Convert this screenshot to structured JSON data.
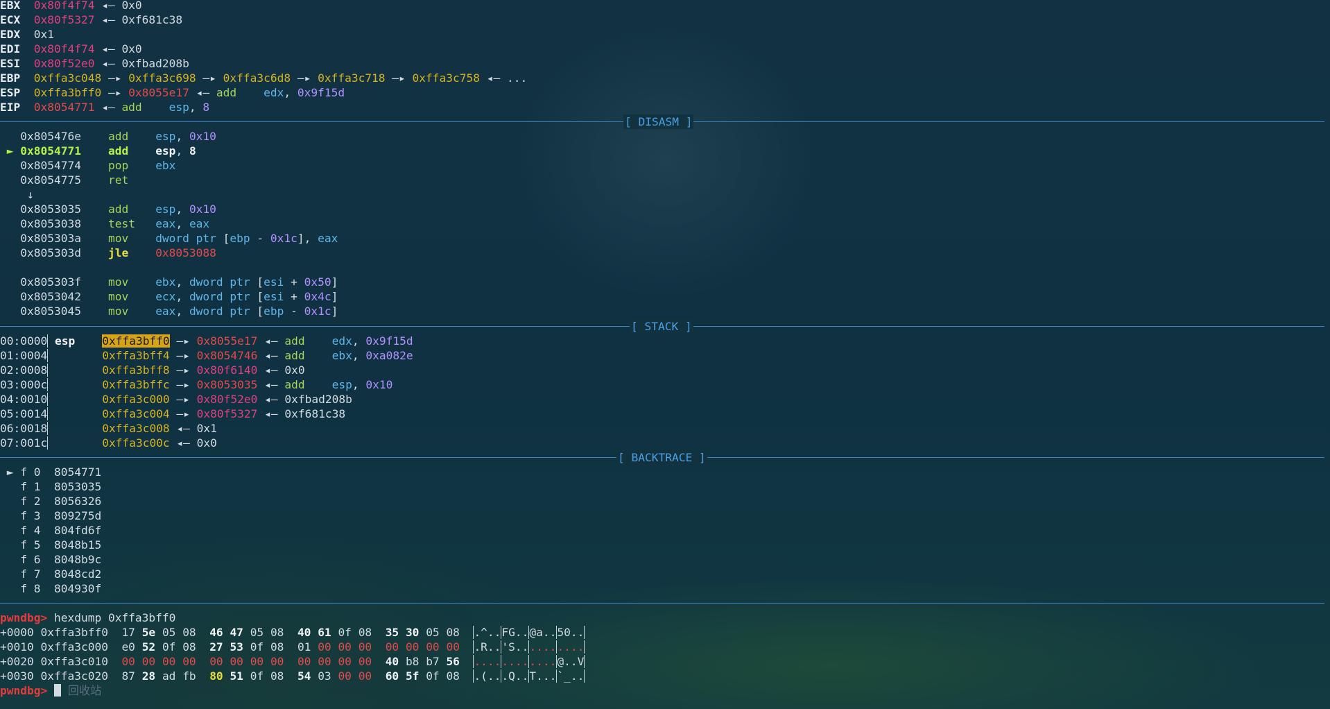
{
  "registers": [
    {
      "name": "EBX",
      "parts": [
        [
          "0x80f4f74",
          "mag"
        ],
        [
          " ◂— ",
          "gray"
        ],
        [
          "0x0",
          "gray"
        ]
      ]
    },
    {
      "name": "ECX",
      "parts": [
        [
          "0x80f5327",
          "mag"
        ],
        [
          " ◂— ",
          "gray"
        ],
        [
          "0xf681c38",
          "gray"
        ]
      ]
    },
    {
      "name": "EDX",
      "parts": [
        [
          "0x1",
          "gray"
        ]
      ]
    },
    {
      "name": "EDI",
      "parts": [
        [
          "0x80f4f74",
          "mag"
        ],
        [
          " ◂— ",
          "gray"
        ],
        [
          "0x0",
          "gray"
        ]
      ]
    },
    {
      "name": "ESI",
      "parts": [
        [
          "0x80f52e0",
          "mag"
        ],
        [
          " ◂— ",
          "gray"
        ],
        [
          "0xfbad208b",
          "gray"
        ]
      ]
    },
    {
      "name": "EBP",
      "parts": [
        [
          "0xffa3c048",
          "yel"
        ],
        [
          " —▸ ",
          "gray"
        ],
        [
          "0xffa3c698",
          "yel"
        ],
        [
          " —▸ ",
          "gray"
        ],
        [
          "0xffa3c6d8",
          "yel"
        ],
        [
          " —▸ ",
          "gray"
        ],
        [
          "0xffa3c718",
          "yel"
        ],
        [
          " —▸ ",
          "gray"
        ],
        [
          "0xffa3c758",
          "yel"
        ],
        [
          " ◂— ...",
          "gray"
        ]
      ]
    },
    {
      "name": "ESP",
      "parts": [
        [
          "0xffa3bff0",
          "yel"
        ],
        [
          " —▸ ",
          "gray"
        ],
        [
          "0x8055e17",
          "red"
        ],
        [
          " ◂— ",
          "gray"
        ],
        [
          "add",
          "grn"
        ],
        [
          "    ",
          "gray"
        ],
        [
          "edx",
          "cya"
        ],
        [
          ", ",
          "gray"
        ],
        [
          "0x9f15d",
          "pur"
        ]
      ]
    },
    {
      "name": "EIP",
      "parts": [
        [
          "0x8054771",
          "red"
        ],
        [
          " ◂— ",
          "gray"
        ],
        [
          "add",
          "grn"
        ],
        [
          "    ",
          "gray"
        ],
        [
          "esp",
          "cya"
        ],
        [
          ", ",
          "gray"
        ],
        [
          "8",
          "pur"
        ]
      ]
    }
  ],
  "sections": {
    "disasm": "[ DISASM ]",
    "stack": "[ STACK ]",
    "backtrace": "[ BACKTRACE ]"
  },
  "disasm": [
    {
      "marker": "",
      "addr": "0x805476e",
      "mn": "add",
      "ops": [
        [
          "esp",
          "cya"
        ],
        [
          ", ",
          "gray"
        ],
        [
          "0x10",
          "pur"
        ]
      ]
    },
    {
      "marker": "►",
      "addr": "0x8054771",
      "mn": "add",
      "ops": [
        [
          "esp",
          "cya"
        ],
        [
          ", ",
          "gray"
        ],
        [
          "8",
          "pur"
        ]
      ],
      "current": true
    },
    {
      "marker": "",
      "addr": "0x8054774",
      "mn": "pop",
      "ops": [
        [
          "ebx",
          "cya"
        ]
      ]
    },
    {
      "marker": "",
      "addr": "0x8054775",
      "mn": "ret",
      "ops": []
    },
    {
      "arrow": "↓"
    },
    {
      "marker": "",
      "addr": "0x8053035",
      "mn": "add",
      "ops": [
        [
          "esp",
          "cya"
        ],
        [
          ", ",
          "gray"
        ],
        [
          "0x10",
          "pur"
        ]
      ]
    },
    {
      "marker": "",
      "addr": "0x8053038",
      "mn": "test",
      "ops": [
        [
          "eax",
          "cya"
        ],
        [
          ", ",
          "gray"
        ],
        [
          "eax",
          "cya"
        ]
      ]
    },
    {
      "marker": "",
      "addr": "0x805303a",
      "mn": "mov",
      "ops": [
        [
          "dword ptr ",
          "cya"
        ],
        [
          "[",
          "gray"
        ],
        [
          "ebp",
          "cya"
        ],
        [
          " - ",
          "gray"
        ],
        [
          "0x1c",
          "pur"
        ],
        [
          "], ",
          "gray"
        ],
        [
          "eax",
          "cya"
        ]
      ]
    },
    {
      "marker": "",
      "addr": "0x805303d",
      "mn": "jle",
      "ops": [
        [
          "0x8053088",
          "red"
        ]
      ],
      "jump": true
    },
    {
      "blank": true
    },
    {
      "marker": "",
      "addr": "0x805303f",
      "mn": "mov",
      "ops": [
        [
          "ebx",
          "cya"
        ],
        [
          ", ",
          "gray"
        ],
        [
          "dword ptr ",
          "cya"
        ],
        [
          "[",
          "gray"
        ],
        [
          "esi",
          "cya"
        ],
        [
          " + ",
          "gray"
        ],
        [
          "0x50",
          "pur"
        ],
        [
          "]",
          "gray"
        ]
      ]
    },
    {
      "marker": "",
      "addr": "0x8053042",
      "mn": "mov",
      "ops": [
        [
          "ecx",
          "cya"
        ],
        [
          ", ",
          "gray"
        ],
        [
          "dword ptr ",
          "cya"
        ],
        [
          "[",
          "gray"
        ],
        [
          "esi",
          "cya"
        ],
        [
          " + ",
          "gray"
        ],
        [
          "0x4c",
          "pur"
        ],
        [
          "]",
          "gray"
        ]
      ]
    },
    {
      "marker": "",
      "addr": "0x8053045",
      "mn": "mov",
      "ops": [
        [
          "eax",
          "cya"
        ],
        [
          ", ",
          "gray"
        ],
        [
          "dword ptr ",
          "cya"
        ],
        [
          "[",
          "gray"
        ],
        [
          "ebp",
          "cya"
        ],
        [
          " - ",
          "gray"
        ],
        [
          "0x1c",
          "pur"
        ],
        [
          "]",
          "gray"
        ]
      ]
    }
  ],
  "stack": [
    {
      "off": "00:0000",
      "reg": "esp",
      "addr": "0xffa3bff0",
      "hl": true,
      "rest": [
        [
          " —▸ ",
          "gray"
        ],
        [
          "0x8055e17",
          "red"
        ],
        [
          " ◂— ",
          "gray"
        ],
        [
          "add",
          "grn"
        ],
        [
          "    ",
          "gray"
        ],
        [
          "edx",
          "cya"
        ],
        [
          ", ",
          "gray"
        ],
        [
          "0x9f15d",
          "pur"
        ]
      ]
    },
    {
      "off": "01:0004",
      "reg": "",
      "addr": "0xffa3bff4",
      "rest": [
        [
          " —▸ ",
          "gray"
        ],
        [
          "0x8054746",
          "red"
        ],
        [
          " ◂— ",
          "gray"
        ],
        [
          "add",
          "grn"
        ],
        [
          "    ",
          "gray"
        ],
        [
          "ebx",
          "cya"
        ],
        [
          ", ",
          "gray"
        ],
        [
          "0xa082e",
          "pur"
        ]
      ]
    },
    {
      "off": "02:0008",
      "reg": "",
      "addr": "0xffa3bff8",
      "rest": [
        [
          " —▸ ",
          "gray"
        ],
        [
          "0x80f6140",
          "mag"
        ],
        [
          " ◂— ",
          "gray"
        ],
        [
          "0x0",
          "gray"
        ]
      ]
    },
    {
      "off": "03:000c",
      "reg": "",
      "addr": "0xffa3bffc",
      "rest": [
        [
          " —▸ ",
          "gray"
        ],
        [
          "0x8053035",
          "red"
        ],
        [
          " ◂— ",
          "gray"
        ],
        [
          "add",
          "grn"
        ],
        [
          "    ",
          "gray"
        ],
        [
          "esp",
          "cya"
        ],
        [
          ", ",
          "gray"
        ],
        [
          "0x10",
          "pur"
        ]
      ]
    },
    {
      "off": "04:0010",
      "reg": "",
      "addr": "0xffa3c000",
      "rest": [
        [
          " —▸ ",
          "gray"
        ],
        [
          "0x80f52e0",
          "mag"
        ],
        [
          " ◂— ",
          "gray"
        ],
        [
          "0xfbad208b",
          "gray"
        ]
      ]
    },
    {
      "off": "05:0014",
      "reg": "",
      "addr": "0xffa3c004",
      "rest": [
        [
          " —▸ ",
          "gray"
        ],
        [
          "0x80f5327",
          "mag"
        ],
        [
          " ◂— ",
          "gray"
        ],
        [
          "0xf681c38",
          "gray"
        ]
      ]
    },
    {
      "off": "06:0018",
      "reg": "",
      "addr": "0xffa3c008",
      "rest": [
        [
          " ◂— ",
          "gray"
        ],
        [
          "0x1",
          "gray"
        ]
      ]
    },
    {
      "off": "07:001c",
      "reg": "",
      "addr": "0xffa3c00c",
      "rest": [
        [
          " ◂— ",
          "gray"
        ],
        [
          "0x0",
          "gray"
        ]
      ]
    }
  ],
  "backtrace": [
    {
      "marker": "►",
      "frame": "f 0",
      "addr": "8054771"
    },
    {
      "marker": "",
      "frame": "f 1",
      "addr": "8053035"
    },
    {
      "marker": "",
      "frame": "f 2",
      "addr": "8056326"
    },
    {
      "marker": "",
      "frame": "f 3",
      "addr": "809275d"
    },
    {
      "marker": "",
      "frame": "f 4",
      "addr": "804fd6f"
    },
    {
      "marker": "",
      "frame": "f 5",
      "addr": "8048b15"
    },
    {
      "marker": "",
      "frame": "f 6",
      "addr": "8048b9c"
    },
    {
      "marker": "",
      "frame": "f 7",
      "addr": "8048cd2"
    },
    {
      "marker": "",
      "frame": "f 8",
      "addr": "804930f"
    }
  ],
  "prompt": "pwndbg>",
  "command": "hexdump 0xffa3bff0",
  "hexdump": [
    {
      "off": "+0000",
      "addr": "0xffa3bff0",
      "groups": [
        [
          [
            "17",
            "gray"
          ],
          [
            "5e",
            "bold"
          ],
          [
            "05",
            "gray"
          ],
          [
            "08",
            "gray"
          ]
        ],
        [
          [
            "46",
            "bold"
          ],
          [
            "47",
            "bold"
          ],
          [
            "05",
            "gray"
          ],
          [
            "08",
            "gray"
          ]
        ],
        [
          [
            "40",
            "bold"
          ],
          [
            "61",
            "bold"
          ],
          [
            "0f",
            "gray"
          ],
          [
            "08",
            "gray"
          ]
        ],
        [
          [
            "35",
            "bold"
          ],
          [
            "30",
            "bold"
          ],
          [
            "05",
            "gray"
          ],
          [
            "08",
            "gray"
          ]
        ]
      ],
      "ascii": [
        [
          [
            ".^..",
            "gray"
          ]
        ],
        [
          [
            "FG..",
            "gray"
          ]
        ],
        [
          [
            "@a..",
            "gray"
          ]
        ],
        [
          [
            "50..",
            "gray"
          ]
        ]
      ]
    },
    {
      "off": "+0010",
      "addr": "0xffa3c000",
      "groups": [
        [
          [
            "e0",
            "gray"
          ],
          [
            "52",
            "bold"
          ],
          [
            "0f",
            "gray"
          ],
          [
            "08",
            "gray"
          ]
        ],
        [
          [
            "27",
            "bold"
          ],
          [
            "53",
            "bold"
          ],
          [
            "0f",
            "gray"
          ],
          [
            "08",
            "gray"
          ]
        ],
        [
          [
            "01",
            "gray"
          ],
          [
            "00",
            "red"
          ],
          [
            "00",
            "red"
          ],
          [
            "00",
            "red"
          ]
        ],
        [
          [
            "00",
            "red"
          ],
          [
            "00",
            "red"
          ],
          [
            "00",
            "red"
          ],
          [
            "00",
            "red"
          ]
        ]
      ],
      "ascii": [
        [
          [
            ".R..",
            "gray"
          ]
        ],
        [
          [
            "'S..",
            "gray"
          ]
        ],
        [
          [
            "....",
            "red"
          ]
        ],
        [
          [
            "....",
            "red"
          ]
        ]
      ]
    },
    {
      "off": "+0020",
      "addr": "0xffa3c010",
      "groups": [
        [
          [
            "00",
            "red"
          ],
          [
            "00",
            "red"
          ],
          [
            "00",
            "red"
          ],
          [
            "00",
            "red"
          ]
        ],
        [
          [
            "00",
            "red"
          ],
          [
            "00",
            "red"
          ],
          [
            "00",
            "red"
          ],
          [
            "00",
            "red"
          ]
        ],
        [
          [
            "00",
            "red"
          ],
          [
            "00",
            "red"
          ],
          [
            "00",
            "red"
          ],
          [
            "00",
            "red"
          ]
        ],
        [
          [
            "40",
            "bold"
          ],
          [
            "b8",
            "gray"
          ],
          [
            "b7",
            "gray"
          ],
          [
            "56",
            "bold"
          ]
        ]
      ],
      "ascii": [
        [
          [
            "....",
            "red"
          ]
        ],
        [
          [
            "....",
            "red"
          ]
        ],
        [
          [
            "....",
            "red"
          ]
        ],
        [
          [
            "@..V",
            "gray"
          ]
        ]
      ]
    },
    {
      "off": "+0030",
      "addr": "0xffa3c020",
      "groups": [
        [
          [
            "87",
            "gray"
          ],
          [
            "28",
            "bold"
          ],
          [
            "ad",
            "gray"
          ],
          [
            "fb",
            "gray"
          ]
        ],
        [
          [
            "80",
            "ylw"
          ],
          [
            "51",
            "bold"
          ],
          [
            "0f",
            "gray"
          ],
          [
            "08",
            "gray"
          ]
        ],
        [
          [
            "54",
            "bold"
          ],
          [
            "03",
            "gray"
          ],
          [
            "00",
            "red"
          ],
          [
            "00",
            "red"
          ]
        ],
        [
          [
            "60",
            "bold"
          ],
          [
            "5f",
            "bold"
          ],
          [
            "0f",
            "gray"
          ],
          [
            "08",
            "gray"
          ]
        ]
      ],
      "ascii": [
        [
          [
            ".(..",
            "gray"
          ]
        ],
        [
          [
            ".Q..",
            "gray"
          ]
        ],
        [
          [
            "T...",
            "gray"
          ]
        ],
        [
          [
            "`_..",
            "gray"
          ]
        ]
      ]
    }
  ],
  "input_hint": "回收站"
}
